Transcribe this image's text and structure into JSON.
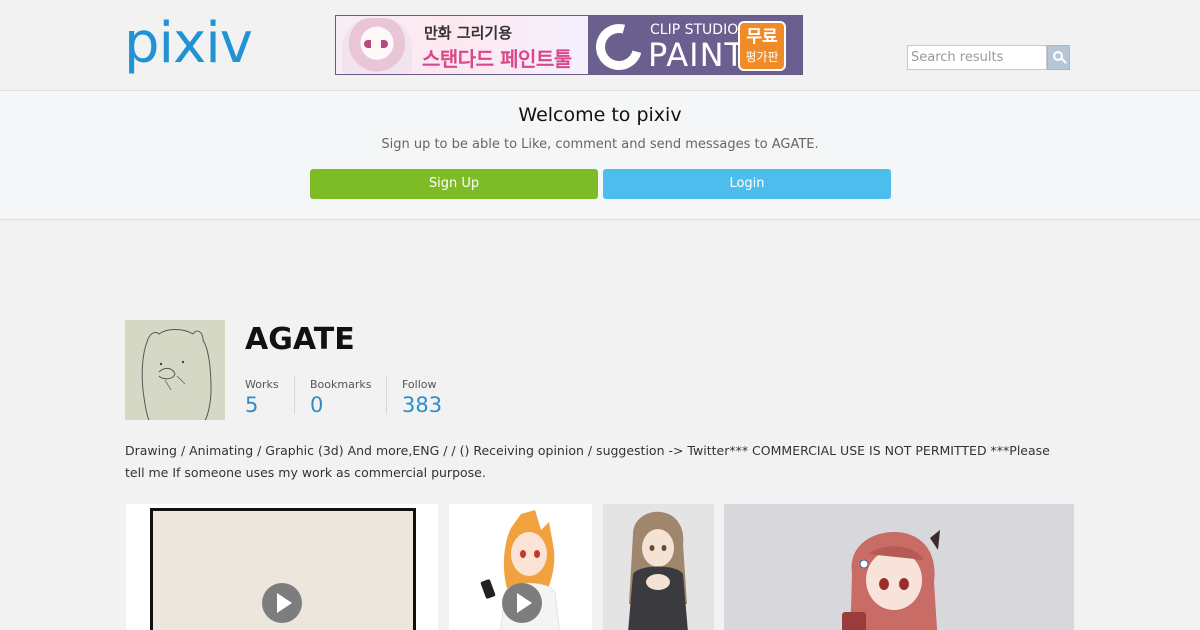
{
  "header": {
    "logo": "pixiv",
    "ad": {
      "line1": "만화 그리기용",
      "line2": "스탠다드 페인트툴",
      "brand_small": "CLIP STUDIO",
      "brand_large": "PAINT",
      "badge_line1": "무료",
      "badge_line2": "평가판"
    },
    "search": {
      "placeholder": "Search results",
      "icon": "search-icon"
    }
  },
  "welcome": {
    "title": "Welcome to pixiv",
    "subtitle": "Sign up to be able to Like, comment and send messages to AGATE.",
    "signup_label": "Sign Up",
    "login_label": "Login",
    "signup_color": "#7ebc27",
    "login_color": "#4dbdee"
  },
  "profile": {
    "username": "AGATE",
    "stats": [
      {
        "label": "Works",
        "value": "5"
      },
      {
        "label": "Bookmarks",
        "value": "0"
      },
      {
        "label": "Follow",
        "value": "383"
      }
    ],
    "bio": "Drawing / Animating / Graphic (3d) And more,ENG /  / ()      Receiving opinion / suggestion -> Twitter*** COMMERCIAL USE IS NOT PERMITTED ***Please tell me If someone uses my work as commercial purpose.",
    "stat_color": "#2e8fc4"
  },
  "works": [
    {
      "kind": "animation",
      "icon": "play-icon"
    },
    {
      "kind": "animation",
      "icon": "play-icon"
    },
    {
      "kind": "illustration"
    },
    {
      "kind": "illustration"
    }
  ]
}
